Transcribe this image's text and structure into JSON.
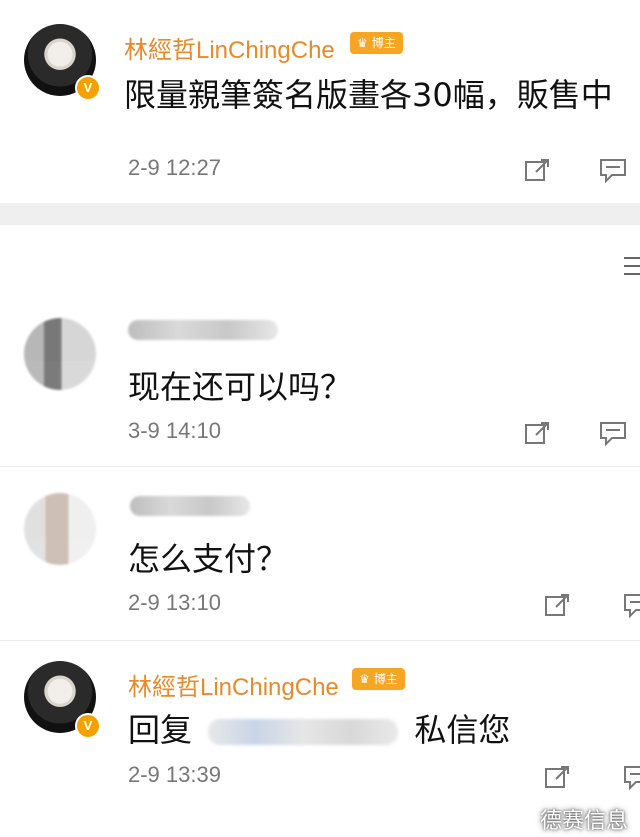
{
  "post": {
    "user_name": "林經哲LinChingChe",
    "badge_label": "博主",
    "content": "限量親筆簽名版畫各30幅，販售中",
    "time": "2-9 12:27"
  },
  "comments": [
    {
      "content": "现在还可以吗？",
      "time": "3-9 14:10"
    },
    {
      "content": "怎么支付？",
      "time": "2-9 13:10"
    },
    {
      "user_name": "林經哲LinChingChe",
      "badge_label": "博主",
      "reply_prefix": "回复",
      "reply_suffix": "私信您",
      "time": "2-9 13:39"
    }
  ],
  "watermark": "德赛信息",
  "icons": {
    "share": "share-icon",
    "comment": "comment-icon",
    "verified": "verified-icon",
    "menu": "menu-icon"
  },
  "colors": {
    "name": "#e8892a",
    "badge": "#f6a623",
    "verified": "#f4a100",
    "time": "#777777"
  }
}
